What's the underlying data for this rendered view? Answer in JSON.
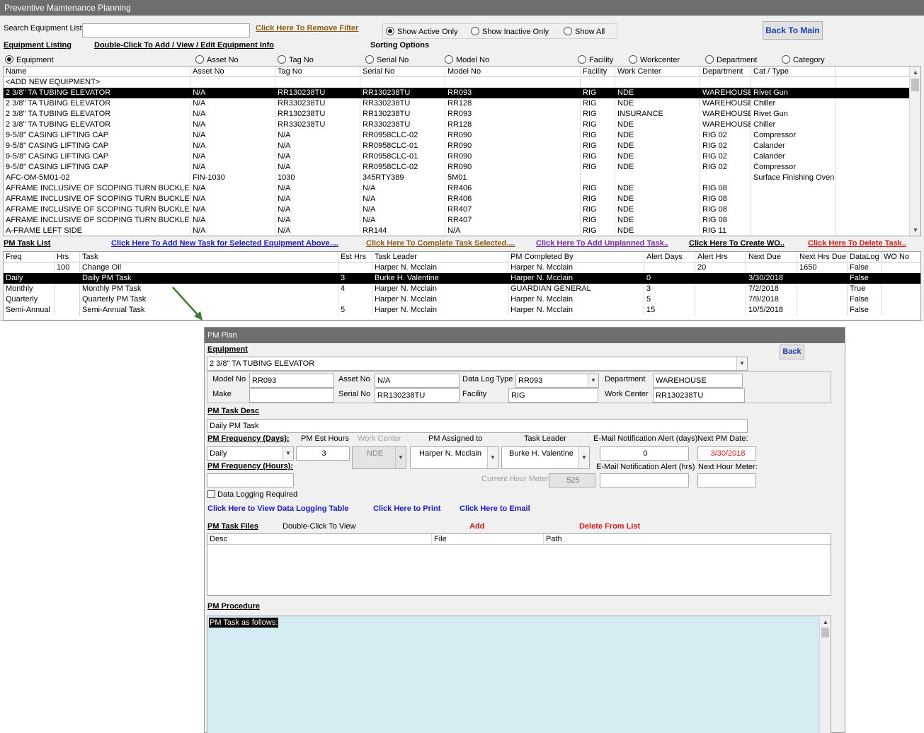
{
  "window_title": "Preventive Maintenance Planning",
  "search": {
    "label": "Search Equipment List",
    "value": ""
  },
  "remove_filter_link": "Click Here To Remove Filter",
  "filter_radios": [
    {
      "label": "Show Active Only",
      "checked": true
    },
    {
      "label": "Show Inactive Only",
      "checked": false
    },
    {
      "label": "Show All",
      "checked": false
    }
  ],
  "back_to_main": "Back To Main",
  "equipment_listing_label": "Equipment Listing",
  "equipment_double_click_link": "Double-Click To Add / View / Edit Equipment Info",
  "sorting_options_label": "Sorting Options",
  "sort_radios": [
    {
      "label": "Equipment",
      "checked": true
    },
    {
      "label": "Asset No",
      "checked": false
    },
    {
      "label": "Tag No",
      "checked": false
    },
    {
      "label": "Serial No",
      "checked": false
    },
    {
      "label": "Model No",
      "checked": false
    },
    {
      "label": "Facility",
      "checked": false
    },
    {
      "label": "Workcenter",
      "checked": false
    },
    {
      "label": "Department",
      "checked": false
    },
    {
      "label": "Category",
      "checked": false
    }
  ],
  "equipment_grid": {
    "columns": [
      "Name",
      "Asset No",
      "Tag No",
      "Serial No",
      "Model No",
      "Facility",
      "Work Center",
      "Department",
      "Cat / Type"
    ],
    "rows": [
      [
        "<ADD NEW EQUIPMENT>",
        "",
        "",
        "",
        "",
        "",
        "",
        "",
        ""
      ],
      [
        "2 3/8\" TA TUBING ELEVATOR",
        "N/A",
        "RR130238TU",
        "RR130238TU",
        "RR093",
        "RIG",
        "NDE",
        "WAREHOUSE",
        "Rivet Gun"
      ],
      [
        "2 3/8\" TA TUBING ELEVATOR",
        "N/A",
        "RR330238TU",
        "RR330238TU",
        "RR128",
        "RIG",
        "NDE",
        "WAREHOUSE",
        "Chiller"
      ],
      [
        "2 3/8\" TA TUBING ELEVATOR",
        "N/A",
        "RR130238TU",
        "RR130238TU",
        "RR093",
        "RIG",
        "INSURANCE",
        "WAREHOUSE",
        "Rivet Gun"
      ],
      [
        "2 3/8\" TA TUBING ELEVATOR",
        "N/A",
        "RR330238TU",
        "RR330238TU",
        "RR128",
        "RIG",
        "NDE",
        "WAREHOUSE",
        "Chiller"
      ],
      [
        "9-5/8\" CASING LIFTING CAP",
        "N/A",
        "N/A",
        "RR0958CLC-02",
        "RR090",
        "RIG",
        "NDE",
        "RIG 02",
        "Compressor"
      ],
      [
        "9-5/8\" CASING LIFTING CAP",
        "N/A",
        "N/A",
        "RR0958CLC-01",
        "RR090",
        "RIG",
        "NDE",
        "RIG 02",
        "Calander"
      ],
      [
        "9-5/8\" CASING LIFTING CAP",
        "N/A",
        "N/A",
        "RR0958CLC-01",
        "RR090",
        "RIG",
        "NDE",
        "RIG 02",
        "Calander"
      ],
      [
        "9-5/8\" CASING LIFTING CAP",
        "N/A",
        "N/A",
        "RR0958CLC-02",
        "RR090",
        "RIG",
        "NDE",
        "RIG 02",
        "Compressor"
      ],
      [
        "AFC-OM-5M01-02",
        "FIN-1030",
        "1030",
        "345RTY389",
        "5M01",
        "",
        "",
        "",
        "Surface Finishing Oven"
      ],
      [
        "AFRAME INCLUSIVE OF SCOPING TURN BUCKLE LEFT",
        "N/A",
        "N/A",
        "N/A",
        "RR406",
        "RIG",
        "NDE",
        "RIG 08",
        ""
      ],
      [
        "AFRAME INCLUSIVE OF SCOPING TURN BUCKLE LEFT",
        "N/A",
        "N/A",
        "N/A",
        "RR406",
        "RIG",
        "NDE",
        "RIG 08",
        ""
      ],
      [
        "AFRAME INCLUSIVE OF SCOPING TURN BUCKLE RIGHT",
        "N/A",
        "N/A",
        "N/A",
        "RR407",
        "RIG",
        "NDE",
        "RIG 08",
        ""
      ],
      [
        "AFRAME INCLUSIVE OF SCOPING TURN BUCKLE RIGHT",
        "N/A",
        "N/A",
        "N/A",
        "RR407",
        "RIG",
        "NDE",
        "RIG 08",
        ""
      ],
      [
        "A-FRAME LEFT SIDE",
        "N/A",
        "N/A",
        "RR144",
        "N/A",
        "RIG",
        "NDE",
        "RIG 11",
        ""
      ]
    ],
    "selected_row": 1
  },
  "pm_task_list_label": "PM Task List",
  "task_links": {
    "add_new": "Click Here To Add New Task for Selected Equipment Above....",
    "complete": "Click Here To Complete Task Selected....",
    "unplanned": "Click Here To Add Unplanned Task..",
    "create_wo": "Click Here To Create WO..",
    "delete": "Click Here To Delete Task.."
  },
  "task_grid": {
    "columns": [
      "Freq",
      "Hrs",
      "Task",
      "Est Hrs",
      "Task Leader",
      "PM Completed By",
      "Alert Days",
      "Alert Hrs",
      "Next Due",
      "Next Hrs Due",
      "DataLog",
      "WO No"
    ],
    "rows": [
      [
        "",
        "100",
        "Change Oil",
        "",
        "Harper N. Mcclain",
        "Harper N. Mcclain",
        "",
        "20",
        "",
        "1650",
        "False",
        ""
      ],
      [
        "Daily",
        "",
        "Daily PM Task",
        "3",
        "Burke H. Valentine",
        "Harper N. Mcclain",
        "0",
        "",
        "3/30/2018",
        "",
        "False",
        ""
      ],
      [
        "Monthly",
        "",
        "Monthly PM Task",
        "4",
        "Harper N. Mcclain",
        "GUARDIAN GENERAL",
        "3",
        "",
        "7/2/2018",
        "",
        "True",
        ""
      ],
      [
        "Quarterly",
        "",
        "Quarterly PM Task",
        "",
        "Harper N. Mcclain",
        "Harper N. Mcclain",
        "5",
        "",
        "7/9/2018",
        "",
        "False",
        ""
      ],
      [
        "Semi-Annual",
        "",
        "Semi-Annual Task",
        "5",
        "Harper N. Mcclain",
        "Harper N. Mcclain",
        "15",
        "",
        "10/5/2018",
        "",
        "False",
        ""
      ]
    ],
    "selected_row": 1
  },
  "pm_plan": {
    "title": "PM Plan",
    "equipment_label": "Equipment",
    "equipment_value": "2 3/8\" TA TUBING ELEVATOR",
    "back_label": "Back",
    "model_no_label": "Model No",
    "model_no": "RR093",
    "asset_no_label": "Asset No",
    "asset_no": "N/A",
    "data_log_type_label": "Data Log Type",
    "data_log_type": "RR093",
    "department_label": "Department",
    "department": "WAREHOUSE",
    "make_label": "Make",
    "make": "",
    "serial_no_label": "Serial No",
    "serial_no": "RR130238TU",
    "facility_label": "Facility",
    "facility": "RIG",
    "work_center_label": "Work Center",
    "work_center": "RR130238TU",
    "task_desc_label": "PM Task Desc",
    "task_desc": "Daily PM Task",
    "freq_days_label": "PM Frequency (Days):",
    "freq_days": "Daily",
    "est_hours_label": "PM Est Hours",
    "est_hours": "3",
    "work_center2_label": "Work Center",
    "work_center2": "NDE",
    "assigned_label": "PM Assigned to",
    "assigned": "Harper N. Mcclain",
    "task_leader_label": "Task Leader",
    "task_leader": "Burke H. Valentine",
    "email_days_label": "E-Mail Notification Alert (days)",
    "email_days": "0",
    "next_pm_label": "Next PM Date:",
    "next_pm": "3/30/2018",
    "freq_hours_label": "PM Frequency (Hours):",
    "freq_hours": "",
    "current_hour_label": "Current Hour Meter",
    "current_hour": "525",
    "email_hrs_label": "E-Mail Notification Alert (hrs)",
    "email_hrs": "",
    "next_hour_label": "Next Hour Meter:",
    "next_hour": "",
    "data_logging_label": "Data Logging Required",
    "data_logging_checked": false,
    "view_data_logging": "Click Here to View Data Logging Table",
    "print_link": "Click Here to Print",
    "email_link": "Click Here to Email",
    "task_files_label": "PM Task Files",
    "double_click_view": "Double-Click To View",
    "add_link": "Add",
    "delete_link": "Delete From List",
    "files_columns": [
      "Desc",
      "File",
      "Path"
    ],
    "procedure_label": "PM Procedure",
    "procedure_text": "PM Task as follows:"
  },
  "colors": {
    "title_bar": "#6e6e6e",
    "link_brown": "#8b5a14",
    "link_blue": "#1a1ad6",
    "link_purple": "#7a2fa8",
    "link_red": "#e01818",
    "next_pm_red": "#e01818",
    "procedure_bg": "#d4ebf2",
    "arrow_green": "#3d7a2a"
  }
}
